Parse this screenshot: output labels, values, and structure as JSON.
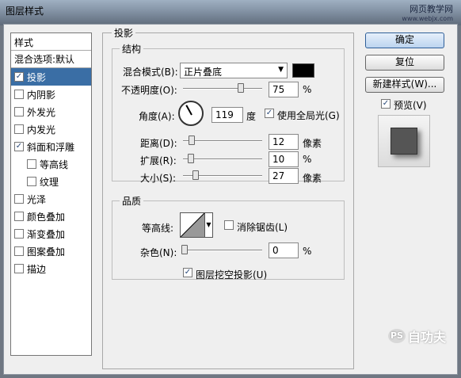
{
  "window": {
    "title": "图层样式"
  },
  "watermark": {
    "site_name": "网页教学网",
    "site_url": "www.webjx.com",
    "brand_text": "PS",
    "brand_name": "自功夫"
  },
  "styles_list": {
    "header": "样式",
    "blend_default": "混合选项:默认",
    "items": [
      {
        "label": "投影",
        "checked": true
      },
      {
        "label": "内阴影",
        "checked": false
      },
      {
        "label": "外发光",
        "checked": false
      },
      {
        "label": "内发光",
        "checked": false
      },
      {
        "label": "斜面和浮雕",
        "checked": true
      },
      {
        "label": "等高线",
        "checked": false
      },
      {
        "label": "纹理",
        "checked": false
      },
      {
        "label": "光泽",
        "checked": false
      },
      {
        "label": "颜色叠加",
        "checked": false
      },
      {
        "label": "渐变叠加",
        "checked": false
      },
      {
        "label": "图案叠加",
        "checked": false
      },
      {
        "label": "描边",
        "checked": false
      }
    ]
  },
  "drop_shadow": {
    "section_title": "投影",
    "structure": {
      "group_title": "结构",
      "blend_mode_label": "混合模式(B):",
      "blend_mode_value": "正片叠底",
      "shadow_color": "#000000",
      "opacity_label": "不透明度(O):",
      "opacity_value": "75",
      "opacity_unit": "%",
      "angle_label": "角度(A):",
      "angle_value": "119",
      "angle_unit": "度",
      "global_light_label": "使用全局光(G)",
      "global_light_checked": true,
      "distance_label": "距离(D):",
      "distance_value": "12",
      "distance_unit": "像素",
      "spread_label": "扩展(R):",
      "spread_value": "10",
      "spread_unit": "%",
      "size_label": "大小(S):",
      "size_value": "27",
      "size_unit": "像素"
    },
    "quality": {
      "group_title": "品质",
      "contour_label": "等高线:",
      "anti_alias_label": "消除锯齿(L)",
      "anti_alias_checked": false,
      "noise_label": "杂色(N):",
      "noise_value": "0",
      "noise_unit": "%"
    },
    "knockout_label": "图层挖空投影(U)",
    "knockout_checked": true
  },
  "buttons": {
    "ok": "确定",
    "reset": "复位",
    "new_style": "新建样式(W)...",
    "preview_label": "预览(V)",
    "preview_checked": true
  }
}
